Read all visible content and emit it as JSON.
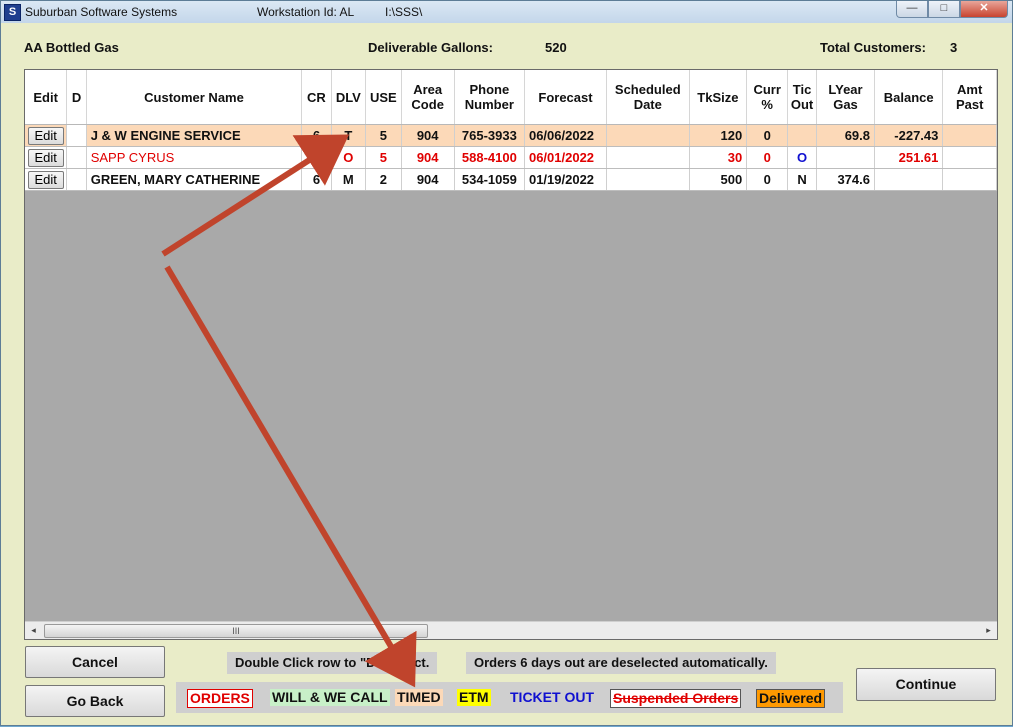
{
  "titlebar": {
    "app": "Suburban Software Systems",
    "workstation": "Workstation Id: AL",
    "path": "I:\\SSS\\"
  },
  "header": {
    "company": "AA Bottled Gas",
    "gallons_label": "Deliverable Gallons:",
    "gallons_value": "520",
    "customers_label": "Total Customers:",
    "customers_value": "3"
  },
  "columns": [
    "Edit",
    "D",
    "Customer Name",
    "CR",
    "DLV",
    "USE",
    "Area Code",
    "Phone Number",
    "Forecast",
    "Scheduled Date",
    "TkSize",
    "Curr %",
    "Tic Out",
    "LYear Gas",
    "Balance",
    "Amt Past"
  ],
  "rows": [
    {
      "edit": "Edit",
      "d": "",
      "name": "J & W ENGINE SERVICE",
      "cr": "6",
      "dlv": "T",
      "use": "5",
      "area": "904",
      "phone": "765-3933",
      "forecast": "06/06/2022",
      "scheduled": "",
      "tksize": "120",
      "curr": "0",
      "tic": "",
      "lyear": "69.8",
      "balance": "-227.43",
      "amt": ""
    },
    {
      "edit": "Edit",
      "d": "",
      "name": "SAPP CYRUS",
      "cr": "6",
      "dlv": "O",
      "use": "5",
      "area": "904",
      "phone": "588-4100",
      "forecast": "06/01/2022",
      "scheduled": "",
      "tksize": "30",
      "curr": "0",
      "tic": "O",
      "lyear": "",
      "balance": "251.61",
      "amt": ""
    },
    {
      "edit": "Edit",
      "d": "",
      "name": "GREEN, MARY CATHERINE",
      "cr": "6",
      "dlv": "M",
      "use": "2",
      "area": "904",
      "phone": "534-1059",
      "forecast": "01/19/2022",
      "scheduled": "",
      "tksize": "500",
      "curr": "0",
      "tic": "N",
      "lyear": "374.6",
      "balance": "",
      "amt": ""
    }
  ],
  "scrollbar": {
    "left": "◂",
    "right": "▸",
    "grip": "III"
  },
  "buttons": {
    "cancel": "Cancel",
    "go_back": "Go Back",
    "continue": "Continue"
  },
  "notes": {
    "double_click": "Double Click row to \"D\"eselect.",
    "auto_deselect": "Orders 6 days out are deselected automatically."
  },
  "legend": [
    {
      "label": "ORDERS",
      "color": "#e00000",
      "bg": "#ffffff",
      "border": "#e00000"
    },
    {
      "label": "WILL & WE CALL",
      "color": "#111111",
      "bg": "#c8f0c8",
      "border": ""
    },
    {
      "label": "TIMED",
      "color": "#111111",
      "bg": "#fcd9b8",
      "border": ""
    },
    {
      "label": "ETM",
      "color": "#111111",
      "bg": "#ffff00",
      "border": ""
    },
    {
      "label": "TICKET OUT",
      "color": "#1010d0",
      "bg": "",
      "border": ""
    },
    {
      "label": "Suspended Orders",
      "color": "#e00000",
      "bg": "#ffffff",
      "border": "#555555"
    },
    {
      "label": "Delivered",
      "color": "#111111",
      "bg": "#ff9900",
      "border": "#555555"
    }
  ],
  "colors": {
    "row_timed_bg": "#fcd9b8",
    "order_text": "#e00000",
    "ticket_out": "#1010d0",
    "arrow": "#c0442c"
  },
  "icons": {
    "app": "sss-logo-icon",
    "minimize": "minimize-icon",
    "maximize": "maximize-icon",
    "close": "close-icon"
  },
  "window_glyphs": {
    "app": "S",
    "minimize": "—",
    "maximize": "□",
    "close": "✕"
  }
}
